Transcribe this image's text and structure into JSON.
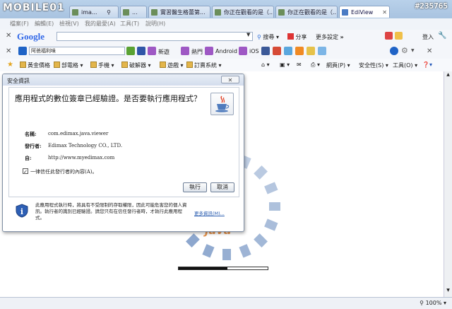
{
  "watermark": "MOBILE01",
  "post_id": "#235765",
  "tabs": [
    {
      "label": "ima..."
    },
    {
      "label": "..."
    },
    {
      "label": "實習醫生格蕾第..."
    },
    {
      "label": "你正在觀看的是（..."
    },
    {
      "label": "你正在觀看的是（..."
    },
    {
      "label": "EdiView"
    }
  ],
  "menu": [
    "檔案(F)",
    "編輯(E)",
    "檢視(V)",
    "我的最愛(A)",
    "工具(T)",
    "說明(H)"
  ],
  "googlebar": {
    "logo": "Google",
    "search_btn": "搜尋",
    "share": "分享",
    "more_settings": "更多設定",
    "more_arrows": "»",
    "login": "登入"
  },
  "toolbar2": {
    "input_value": "阿爸福利味",
    "items": [
      "新遊",
      "熱門",
      "Android",
      "iOS"
    ]
  },
  "bookmarks": [
    "黃金價格",
    "部電格",
    "手機",
    "破解器",
    "遊戲",
    "訂賣系統"
  ],
  "ie_tools": [
    "網頁(P)",
    "安全性(S)",
    "工具(O)"
  ],
  "dialog": {
    "title": "安全資訊",
    "close": "✕",
    "question": "應用程式的數位簽章已經驗證。是否要執行應用程式？",
    "name_label": "名稱:",
    "name_value": "com.edimax.java.viewer",
    "publisher_label": "發行者:",
    "publisher_value": "Edimax Technology CO., LTD.",
    "from_label": "自:",
    "from_value": "http://www.myedimax.com",
    "trust_checked": true,
    "trust_label": "一律信任此發行者的內容(A)。",
    "run_label": "執行",
    "cancel_label": "取消",
    "info_text": "此應用程式執行時，將具有不受限制的存取權限，因此可能危害您的個人資訊。執行者的識別已經驗證。請您只有在信任發行者時，才執行此應用程式。",
    "more_info": "更多資訊(M)..."
  },
  "java_loader": {
    "text": "java",
    "progress": 0.55
  },
  "status": {
    "zoom": "100%"
  }
}
